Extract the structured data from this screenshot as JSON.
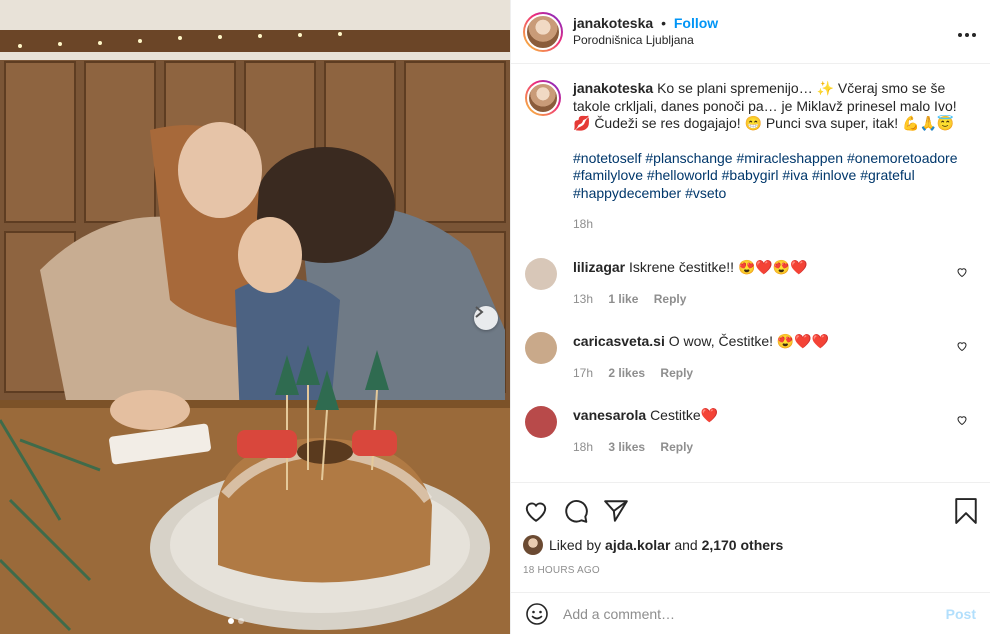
{
  "post": {
    "photo_description_icon": "carousel-photo",
    "carousel_count": 2,
    "carousel_active": 1
  },
  "header": {
    "username": "janakoteska",
    "separator": "•",
    "follow_label": "Follow",
    "location": "Porodnišnica Ljubljana",
    "more_icon": "more-horizontal-icon"
  },
  "caption": {
    "username": "janakoteska",
    "text": "Ko se plani spremenijo… ✨ Včeraj smo se še takole crkljali, danes ponoči pa… je Miklavž prinesel malo Ivo! 💋 Čudeži se res dogajajo! 😁 Punci sva super, itak! 💪🙏😇",
    "hashtags": [
      "#notetoself",
      "#planschange",
      "#miracleshappen",
      "#onemoretoadore",
      "#familylove",
      "#helloworld",
      "#babygirl",
      "#iva",
      "#inlove",
      "#grateful",
      "#happydecember",
      "#vseto"
    ],
    "time": "18h"
  },
  "comments": [
    {
      "username": "lilizagar",
      "text": "Iskrene čestitke!! 😍❤️😍❤️",
      "time": "13h",
      "likes": "1 like",
      "reply": "Reply",
      "avatar_color": "#d8c7b8"
    },
    {
      "username": "caricasveta.si",
      "text": "O wow, Čestitke! 😍❤️❤️",
      "time": "17h",
      "likes": "2 likes",
      "reply": "Reply",
      "avatar_color": "#c9a98a"
    },
    {
      "username": "vanesarola",
      "text": "Cestitke❤️",
      "time": "18h",
      "likes": "3 likes",
      "reply": "Reply",
      "avatar_color": "#b84a4a"
    }
  ],
  "actions": {
    "liked_by_prefix": "Liked by",
    "liked_by_user": "ajda.kolar",
    "and": "and",
    "others": "2,170 others",
    "time_ago": "18 HOURS AGO"
  },
  "add_comment": {
    "placeholder": "Add a comment…",
    "post_label": "Post"
  }
}
